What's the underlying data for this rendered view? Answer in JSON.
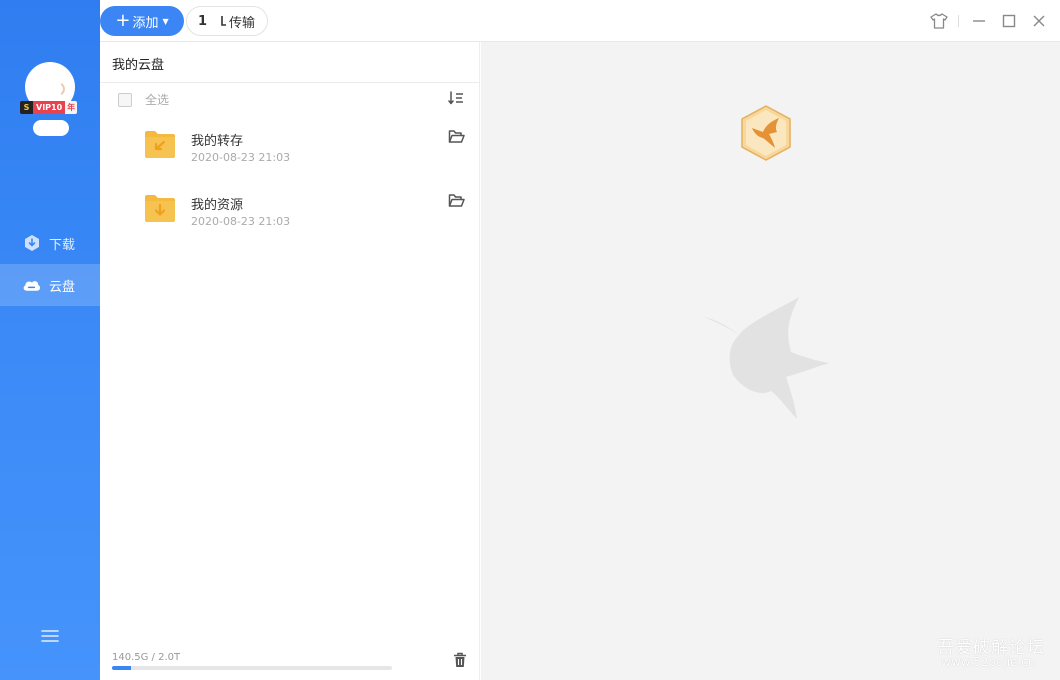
{
  "sidebar": {
    "vip": {
      "s": "S",
      "label": "VIP10",
      "year": "年"
    },
    "nav": [
      {
        "label": "下载",
        "icon": "download-icon",
        "active": false
      },
      {
        "label": "云盘",
        "icon": "cloud-icon",
        "active": true
      }
    ],
    "menu_icon": "hamburger-menu-icon"
  },
  "toolbar": {
    "add_label": "添加",
    "transfer_count": "1",
    "transfer_label": "传输",
    "controls": [
      "skin-icon",
      "minimize-icon",
      "maximize-icon",
      "close-icon"
    ]
  },
  "file_panel": {
    "breadcrumb": "我的云盘",
    "select_all_label": "全选",
    "items": [
      {
        "name": "我的转存",
        "date": "2020-08-23 21:03",
        "icon": "folder-transfer-icon"
      },
      {
        "name": "我的资源",
        "date": "2020-08-23 21:03",
        "icon": "folder-download-icon"
      }
    ],
    "storage": {
      "text": "140.5G / 2.0T",
      "used_fraction": 0.0686
    }
  },
  "watermark": {
    "title": "吾爱破解论坛",
    "url": "www.52pojie.cn"
  },
  "colors": {
    "accent": "#3b85f5",
    "sidebar_top": "#2f7df0",
    "folder": "#f5b93f",
    "logo": "#e59236"
  }
}
